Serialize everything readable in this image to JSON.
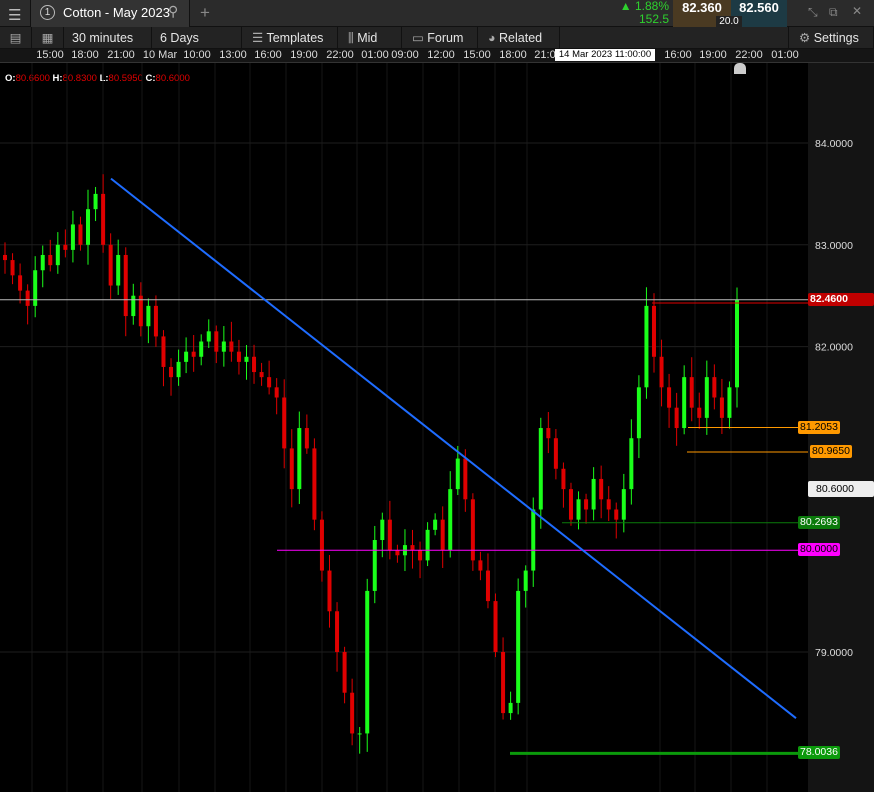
{
  "header": {
    "title": "Cotton - May 2023",
    "instrument_number": "1",
    "change_pct": "1.88%",
    "change_pts": "152.5",
    "sell": "82.360",
    "buy": "82.560",
    "spread": "20.0"
  },
  "toolbar": {
    "interval": "30 minutes",
    "range": "6 Days",
    "templates": "Templates",
    "mid": "Mid",
    "forum": "Forum",
    "related": "Related",
    "settings": "Settings"
  },
  "time_axis": {
    "labels": [
      "15:00",
      "18:00",
      "21:00",
      "10 Mar",
      "10:00",
      "13:00",
      "16:00",
      "19:00",
      "22:00",
      "01:00",
      "09:00",
      "12:00",
      "15:00",
      "18:00",
      "21:0",
      "16:00",
      "19:00",
      "22:00",
      "01:00"
    ],
    "crosshair_time": "14 Mar 2023 11:00:00"
  },
  "ohlc": {
    "o_label": "O:",
    "o": "80.6600",
    "h_label": "H:",
    "h": "80.8300",
    "l_label": "L:",
    "l": "80.5950",
    "c_label": "C:",
    "c": "80.6000"
  },
  "price_axis": {
    "ticks": [
      "84.0000",
      "83.0000",
      "82.0000",
      "79.0000"
    ]
  },
  "chart_data": {
    "type": "candlestick",
    "ylim": [
      77.6,
      84.6
    ],
    "closes": [
      82.85,
      82.7,
      82.55,
      82.4,
      82.75,
      82.9,
      82.8,
      83.0,
      82.95,
      83.2,
      83.0,
      83.35,
      83.5,
      83.0,
      82.6,
      82.9,
      82.3,
      82.5,
      82.2,
      82.4,
      82.1,
      81.8,
      81.7,
      81.85,
      81.95,
      81.9,
      82.05,
      82.15,
      81.95,
      82.05,
      81.95,
      81.85,
      81.9,
      81.75,
      81.7,
      81.6,
      81.5,
      81.0,
      80.6,
      81.2,
      81.0,
      80.3,
      79.8,
      79.4,
      79.0,
      78.6,
      78.2,
      78.2,
      79.6,
      80.1,
      80.3,
      80.0,
      79.95,
      80.05,
      80.0,
      79.9,
      80.2,
      80.3,
      80.0,
      80.6,
      80.9,
      80.5,
      79.9,
      79.8,
      79.5,
      79.0,
      78.4,
      78.5,
      79.6,
      79.8,
      80.4,
      81.2,
      81.1,
      80.8,
      80.6,
      80.3,
      80.5,
      80.4,
      80.7,
      80.5,
      80.4,
      80.3,
      80.6,
      81.1,
      81.6,
      82.4,
      81.9,
      81.6,
      81.4,
      81.2,
      81.7,
      81.4,
      81.3,
      81.7,
      81.5,
      81.3,
      81.6,
      82.46
    ],
    "trendline": {
      "from": 83.65,
      "to": 78.35,
      "color": "#1e6cff"
    },
    "levels": [
      {
        "value": "82.4600",
        "price": 82.46,
        "color": "#c00000",
        "text": "#fff"
      },
      {
        "value": "81.2053",
        "price": 81.2053,
        "color": "#ff9900",
        "text": "#000"
      },
      {
        "value": "80.9650",
        "price": 80.965,
        "color": "#ff9900",
        "text": "#000"
      },
      {
        "value": "80.6000",
        "price": 80.6,
        "color": "#eeeeee",
        "text": "#000"
      },
      {
        "value": "80.2693",
        "price": 80.2693,
        "color": "#0b7a0b",
        "text": "#fff"
      },
      {
        "value": "80.0000",
        "price": 80.0,
        "color": "#ff00ff",
        "text": "#000"
      },
      {
        "value": "78.0036",
        "price": 78.0036,
        "color": "#0b9a0b",
        "text": "#fff"
      }
    ],
    "up_color": "#1aff1a",
    "down_color": "#e00000"
  }
}
